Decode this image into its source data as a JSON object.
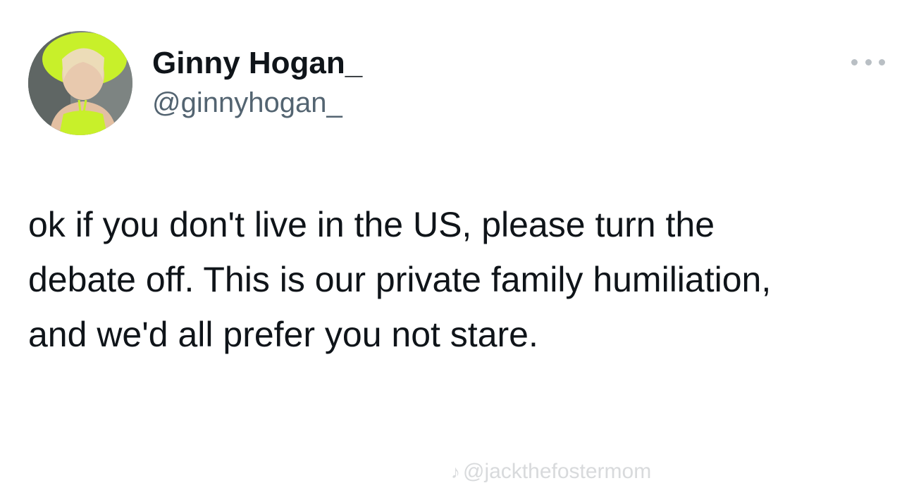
{
  "tweet": {
    "author": {
      "display_name": "Ginny Hogan_",
      "handle": "@ginnyhogan_",
      "avatar_icon": "profile-photo",
      "avatar_accent": "#c8f02a"
    },
    "more_icon": "ellipsis-icon",
    "text": "ok if you don't live in the US, please turn the\ndebate off. This is our private family humiliation,\nand we'd all prefer you not stare."
  },
  "watermark": {
    "icon": "tiktok-icon",
    "text": "@jackthefostermom"
  },
  "colors": {
    "text_primary": "#0f1419",
    "text_secondary": "#536471",
    "background": "#ffffff"
  }
}
